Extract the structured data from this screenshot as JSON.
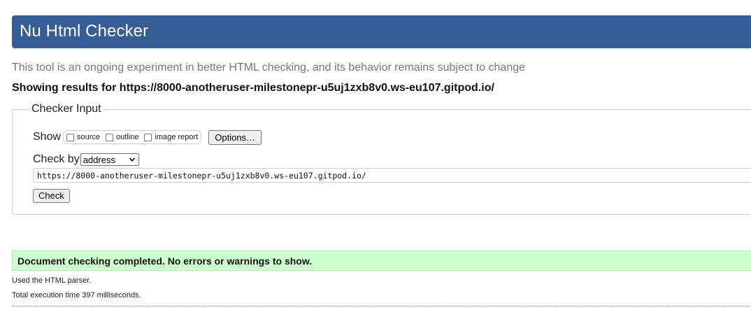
{
  "header": {
    "title": "Nu Html Checker"
  },
  "tagline": "This tool is an ongoing experiment in better HTML checking, and its behavior remains subject to change",
  "results_for": "Showing results for https://8000-anotheruser-milestonepr-u5uj1zxb8v0.ws-eu107.gitpod.io/",
  "checker_input": {
    "legend": "Checker Input",
    "show_label": "Show",
    "show_options": [
      {
        "label": "source",
        "checked": false
      },
      {
        "label": "outline",
        "checked": false
      },
      {
        "label": "image report",
        "checked": false
      }
    ],
    "options_button": "Options…",
    "check_by_label": "Check by",
    "check_by_selected": "address",
    "url_value": "https://8000-anotheruser-milestonepr-u5uj1zxb8v0.ws-eu107.gitpod.io/",
    "check_button": "Check"
  },
  "result": {
    "message": "Document checking completed. No errors or warnings to show.",
    "parser_note": "Used the HTML parser.",
    "timing_note": "Total execution time 397 milliseconds."
  },
  "colors": {
    "header_bg": "#365d95",
    "success_bg": "#ccffcc",
    "tagline_text": "#777777"
  },
  "icons": {
    "select_arrow": "chevron-down-icon"
  }
}
